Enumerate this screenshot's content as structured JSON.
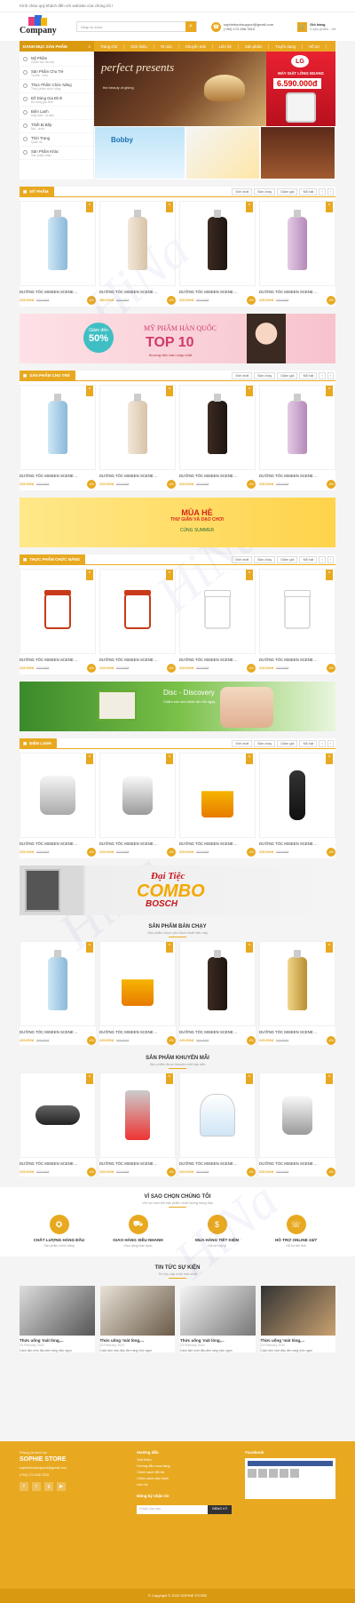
{
  "topbar": {
    "welcome": "Kính chào quý khách đến với website của chúng tôi !"
  },
  "header": {
    "logo_text": "Company",
    "search_placeholder": "Nhập từ khóa",
    "email": "sophiebooksupport@gmail.com",
    "phone": "(+84) 172.456.7810",
    "cart_label": "Giỏ hàng",
    "cart_count": "0 sản phẩm - 0đ"
  },
  "nav": {
    "category": "DANH MỤC SẢN PHẨM",
    "items": [
      "Trang chủ",
      "Giới thiệu",
      "Tin tức",
      "Khuyến mãi",
      "Liên hệ",
      "Sản phẩm",
      "Tuyển dụng",
      "Hỗ trợ"
    ]
  },
  "sidebar": {
    "items": [
      {
        "name": "Mỹ Phẩm",
        "sub": "Chăm sóc da mặt"
      },
      {
        "name": "Sản Phẩm Cho Trẻ",
        "sub": "Tã bỉm - sữa"
      },
      {
        "name": "Thực Phẩm Chức Năng",
        "sub": "Thực phẩm chức năng"
      },
      {
        "name": "Đồ Dùng Gia Đình",
        "sub": "Đồ dùng gia đình"
      },
      {
        "name": "Điện Lạnh",
        "sub": "Máy lạnh - tủ lạnh"
      },
      {
        "name": "Thiết Bị Bếp",
        "sub": "Nồi - chảo"
      },
      {
        "name": "Thời Trang",
        "sub": "Quần áo"
      },
      {
        "name": "Sản Phẩm Khác",
        "sub": "Sản phẩm khác"
      }
    ]
  },
  "hero": {
    "main_title": "perfect presents",
    "main_sub": "the beauty of giving",
    "side_brand": "LG",
    "side_title": "MÁY GIẶT LỒNG NGANG",
    "side_price": "6.590.000đ",
    "bottom1": "Bobby"
  },
  "tabs": [
    "Mới nhất",
    "Bán chạy",
    "Giảm giá",
    "Nổi bật"
  ],
  "sections": [
    {
      "title": "MỸ PHẨM",
      "products": [
        {
          "name": "DƯỠNG TÓC MISEEN SCENE ...",
          "price": "225.000đ",
          "old": "320.000đ",
          "sale": "-6%"
        },
        {
          "name": "DƯỠNG TÓC MISEEN SCENE ...",
          "price": "350.000đ",
          "old": "420.000đ",
          "sale": "-6%"
        },
        {
          "name": "DƯỠNG TÓC MISEEN SCENE ...",
          "price": "225.000đ",
          "old": "320.000đ",
          "sale": "-6%"
        },
        {
          "name": "DƯỠNG TÓC MISEEN SCENE ...",
          "price": "225.000đ",
          "old": "320.000đ",
          "sale": "-6%"
        }
      ]
    },
    {
      "title": "SẢN PHẨM CHO TRẺ",
      "products": [
        {
          "name": "DƯỠNG TÓC MISEEN SCENE ...",
          "price": "225.000đ",
          "old": "320.000đ",
          "sale": "-6%"
        },
        {
          "name": "DƯỠNG TÓC MISEEN SCENE ...",
          "price": "225.000đ",
          "old": "320.000đ",
          "sale": "-6%"
        },
        {
          "name": "DƯỠNG TÓC MISEEN SCENE ...",
          "price": "225.000đ",
          "old": "320.000đ",
          "sale": "-6%"
        },
        {
          "name": "DƯỠNG TÓC MISEEN SCENE ...",
          "price": "225.000đ",
          "old": "320.000đ",
          "sale": "-6%"
        }
      ]
    },
    {
      "title": "THỰC PHẨM CHỨC NĂNG",
      "products": [
        {
          "name": "DƯỠNG TÓC MISEEN SCENE ...",
          "price": "225.000đ",
          "old": "320.000đ",
          "sale": "-6%"
        },
        {
          "name": "DƯỠNG TÓC MISEEN SCENE ...",
          "price": "225.000đ",
          "old": "320.000đ",
          "sale": "-6%"
        },
        {
          "name": "DƯỠNG TÓC MISEEN SCENE ...",
          "price": "225.000đ",
          "old": "320.000đ",
          "sale": "-6%"
        },
        {
          "name": "DƯỠNG TÓC MISEEN SCENE ...",
          "price": "225.000đ",
          "old": "320.000đ",
          "sale": "-6%"
        }
      ]
    },
    {
      "title": "ĐIỆN LẠNH",
      "products": [
        {
          "name": "DƯỠNG TÓC MISEEN SCENE ...",
          "price": "225.000đ",
          "old": "320.000đ",
          "sale": "-6%"
        },
        {
          "name": "DƯỠNG TÓC MISEEN SCENE ...",
          "price": "225.000đ",
          "old": "320.000đ",
          "sale": "-6%"
        },
        {
          "name": "DƯỠNG TÓC MISEEN SCENE ...",
          "price": "225.000đ",
          "old": "320.000đ",
          "sale": "-6%"
        },
        {
          "name": "DƯỠNG TÓC MISEEN SCENE ...",
          "price": "225.000đ",
          "old": "320.000đ",
          "sale": "-6%"
        }
      ]
    }
  ],
  "ads": {
    "ad1": {
      "circle_top": "Giảm đến",
      "circle_big": "50%",
      "t1": "MỸ PHẨM HÀN QUỐC",
      "t2": "TOP 10",
      "t3": "thương hiệu bán chạy nhất"
    },
    "ad2": {
      "t1": "MÙA HÈ",
      "t2": "THƯ GIÃN VÀ DẠO CHƠI",
      "t3": "CÙNG SUMMER"
    },
    "ad3": {
      "t1": "Disc - Discovery",
      "t2": "Chăm sóc sức khỏe bé mỗi ngày"
    },
    "ad4": {
      "t1": "Đại Tiệc",
      "t2": "COMBO",
      "t3": "BOSCH"
    }
  },
  "bestseller": {
    "title": "SẢN PHẨM BÁN CHẠY",
    "sub": "Sản phẩm được yêu thích nhất hiện nay",
    "products": [
      {
        "name": "DƯỠNG TÓC MISEEN SCENE ...",
        "price": "225.000đ",
        "old": "320.000đ",
        "sale": "-6%"
      },
      {
        "name": "DƯỠNG TÓC MISEEN SCENE ...",
        "price": "225.000đ",
        "old": "320.000đ",
        "sale": "-6%"
      },
      {
        "name": "DƯỠNG TÓC MISEEN SCENE ...",
        "price": "225.000đ",
        "old": "320.000đ",
        "sale": "-6%"
      },
      {
        "name": "DƯỠNG TÓC MISEEN SCENE ...",
        "price": "225.000đ",
        "old": "320.000đ",
        "sale": "-6%"
      }
    ]
  },
  "promo": {
    "title": "SẢN PHẨM KHUYẾN MÃI",
    "sub": "Sản phẩm được khuyến mãi hấp dẫn",
    "products": [
      {
        "name": "DƯỠNG TÓC MISEEN SCENE ...",
        "price": "225.000đ",
        "old": "320.000đ",
        "sale": "-6%"
      },
      {
        "name": "DƯỠNG TÓC MISEEN SCENE ...",
        "price": "225.000đ",
        "old": "320.000đ",
        "sale": "-6%"
      },
      {
        "name": "DƯỠNG TÓC MISEEN SCENE ...",
        "price": "225.000đ",
        "old": "320.000đ",
        "sale": "-6%"
      },
      {
        "name": "DƯỠNG TÓC MISEEN SCENE ...",
        "price": "225.000đ",
        "old": "320.000đ",
        "sale": "-6%"
      }
    ]
  },
  "why": {
    "title": "VÌ SAO CHỌN CHÚNG TÔI",
    "sub": "Với sự cam kết sản phẩm chất lượng hàng đầu",
    "items": [
      {
        "t": "CHẤT LƯỢNG HÀNG ĐẦU",
        "d": "Sản phẩm chính hãng"
      },
      {
        "t": "GIAO HÀNG SIÊU NHANH",
        "d": "Giao hàng toàn quốc"
      },
      {
        "t": "MUA HÀNG TIẾT KIỆM",
        "d": "Giá cả hợp lý"
      },
      {
        "t": "HỖ TRỢ ONLINE 24/7",
        "d": "Hỗ trợ tận tình"
      }
    ]
  },
  "news": {
    "title": "TIN TỨC SỰ KIỆN",
    "sub": "Tin tức cập nhật mới nhất",
    "items": [
      {
        "t": "Thức uống 'mát lòng,...",
        "d": "23 February 2020",
        "x": "Cách làm món đậu đen rang mộc ngon"
      },
      {
        "t": "Thức uống 'mát lòng,...",
        "d": "23 February 2020",
        "x": "Cách làm món đậu đen rang mộc ngon"
      },
      {
        "t": "Thức uống 'mát lòng,...",
        "d": "23 February 2020",
        "x": "Cách làm món đậu đen rang mộc ngon"
      },
      {
        "t": "Thức uống 'mát lòng,...",
        "d": "23 February 2020",
        "x": "Cách làm món đậu đen rang mộc ngon"
      }
    ]
  },
  "footer": {
    "pre": "Phòng tin thời trà",
    "store": "SOPHIE STORE",
    "c2_title": "Hướng dẫn",
    "c2_items": [
      "Giới thiệu",
      "Hướng dẫn mua hàng",
      "Chính sách đổi trả",
      "Chính sách bảo hành",
      "Liên hệ"
    ],
    "newsletter_title": "Đăng ký nhận tin",
    "newsletter_placeholder": "Email của bạn",
    "newsletter_btn": "ĐĂNG KÝ",
    "c3_title": "Facebook",
    "copyright": "© Copyright © 2020 SOPHIE STORE"
  }
}
